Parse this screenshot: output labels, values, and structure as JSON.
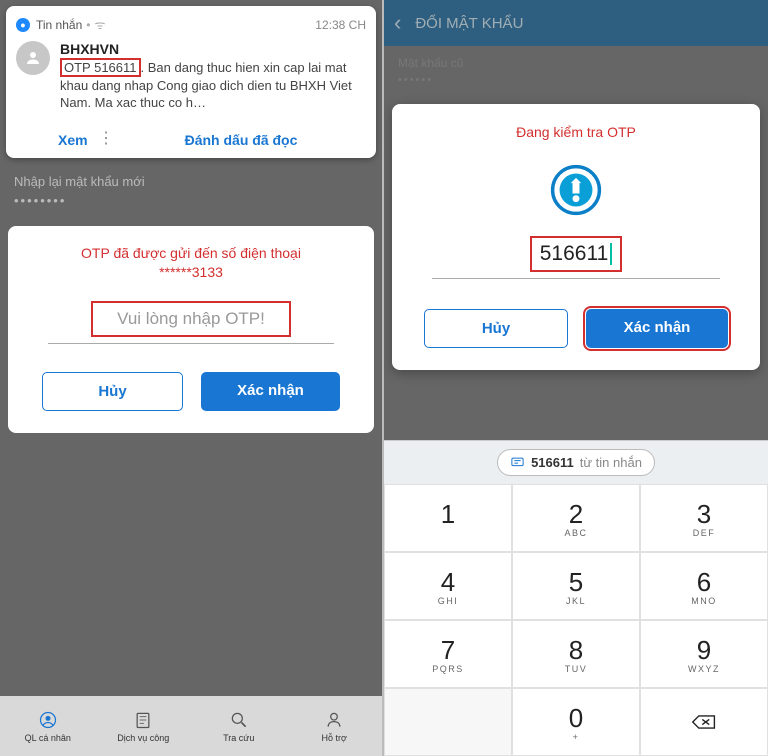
{
  "left": {
    "sms": {
      "app": "Tin nhắn",
      "time": "12:38 CH",
      "sender": "BHXHVN",
      "otp_line": "OTP 516611",
      "body_rest": ". Ban dang thuc hien xin cap lai mat khau dang nhap Cong giao dich dien tu BHXH Viet Nam. Ma xac thuc co h…",
      "view": "Xem",
      "mark_read": "Đánh dấu đã đọc"
    },
    "bg": {
      "label": "Nhập lại mật khẩu mới",
      "dots": "••••••••"
    },
    "otp": {
      "title_line1": "OTP đã được gửi đến số điện thoại",
      "title_line2": "******3133",
      "placeholder": "Vui lòng nhập OTP!",
      "cancel": "Hủy",
      "confirm": "Xác nhận"
    },
    "nav": [
      "QL cá nhân",
      "Dịch vụ công",
      "Tra cứu",
      "Hỗ trợ"
    ]
  },
  "right": {
    "header": "ĐỔI MẬT KHẨU",
    "bg": {
      "label": "Mật khẩu cũ",
      "dots": "••••••"
    },
    "otp": {
      "title": "Đang kiểm tra OTP",
      "value": "516611",
      "cancel": "Hủy",
      "confirm": "Xác nhận"
    },
    "suggest": {
      "code": "516611",
      "from": "từ tin nhắn"
    },
    "keys": {
      "k1": "1",
      "k2": "2",
      "k3": "3",
      "k4": "4",
      "k5": "5",
      "k6": "6",
      "k7": "7",
      "k8": "8",
      "k9": "9",
      "k0": "0",
      "s2": "ABC",
      "s3": "DEF",
      "s4": "GHI",
      "s5": "JKL",
      "s6": "MNO",
      "s7": "PQRS",
      "s8": "TUV",
      "s9": "WXYZ",
      "s0": "+"
    }
  }
}
